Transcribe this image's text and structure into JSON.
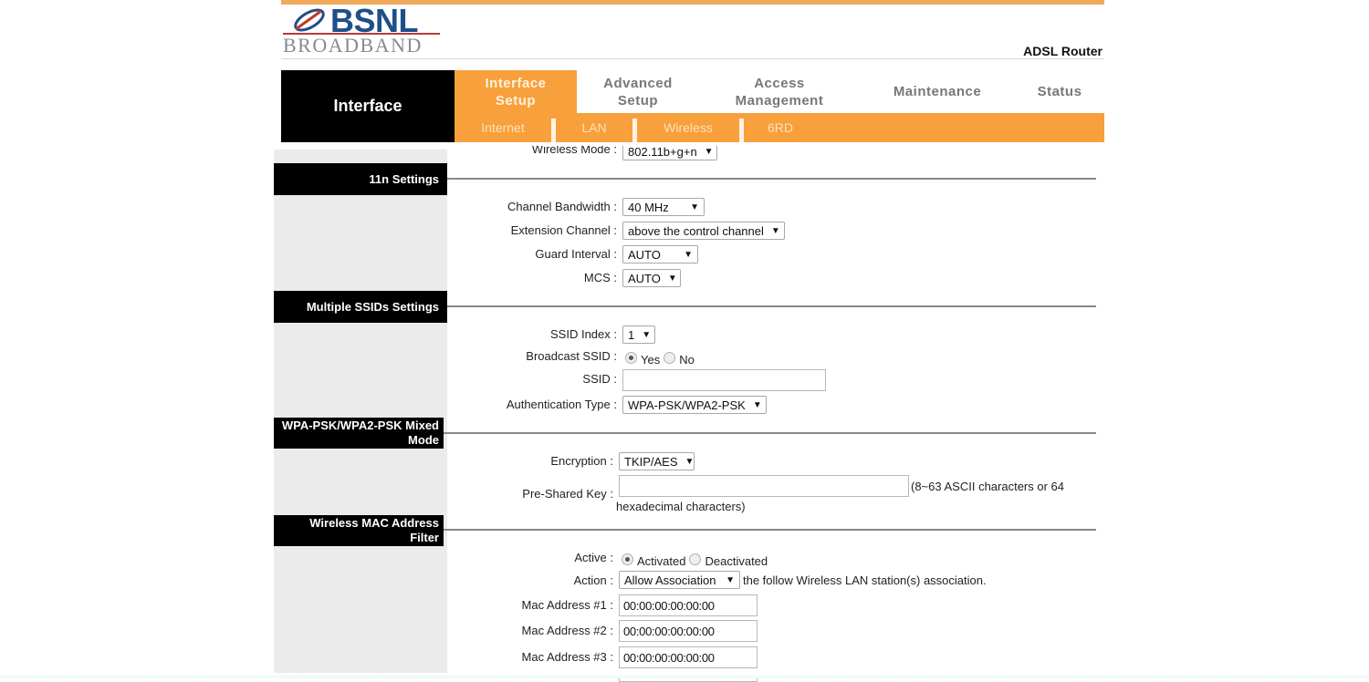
{
  "header": {
    "logo_brand": "BSNL",
    "logo_sub": "BROADBAND",
    "product": "ADSL Router",
    "colors": {
      "accent": "#f7a03c",
      "brand_blue": "#1f4f8a",
      "nav_black": "#000000"
    }
  },
  "nav": {
    "section": "Interface",
    "tabs": [
      {
        "label": "Interface Setup",
        "line1": "Interface",
        "line2": "Setup",
        "active": true
      },
      {
        "label": "Advanced Setup",
        "line1": "Advanced",
        "line2": "Setup",
        "active": false
      },
      {
        "label": "Access Management",
        "line1": "Access",
        "line2": "Management",
        "active": false
      },
      {
        "label": "Maintenance",
        "line1": "Maintenance",
        "line2": "",
        "active": false
      },
      {
        "label": "Status",
        "line1": "Status",
        "line2": "",
        "active": false
      }
    ],
    "subtabs": [
      "Internet",
      "LAN",
      "Wireless",
      "6RD"
    ]
  },
  "wireless_mode": {
    "label": "Wireless Mode :",
    "value": "802.11b+g+n"
  },
  "sections": {
    "n11": {
      "title": "11n Settings",
      "channel_bandwidth": {
        "label": "Channel Bandwidth :",
        "value": "40 MHz"
      },
      "extension_channel": {
        "label": "Extension Channel :",
        "value": "above the control channel"
      },
      "guard_interval": {
        "label": "Guard Interval :",
        "value": "AUTO"
      },
      "mcs": {
        "label": "MCS :",
        "value": "AUTO"
      }
    },
    "ssid": {
      "title": "Multiple SSIDs Settings",
      "ssid_index": {
        "label": "SSID Index :",
        "value": "1"
      },
      "broadcast": {
        "label": "Broadcast SSID :",
        "options": [
          "Yes",
          "No"
        ],
        "selected": "Yes"
      },
      "ssid": {
        "label": "SSID :",
        "value": ""
      },
      "auth_type": {
        "label": "Authentication Type :",
        "value": "WPA-PSK/WPA2-PSK"
      }
    },
    "wpa": {
      "title_line1": "WPA-PSK/WPA2-PSK Mixed",
      "title_line2": "Mode",
      "encryption": {
        "label": "Encryption :",
        "value": "TKIP/AES"
      },
      "psk": {
        "label": "Pre-Shared Key :",
        "value": "",
        "hint_line1": "(8~63 ASCII characters or 64",
        "hint_line2": "hexadecimal characters)"
      }
    },
    "mac_filter": {
      "title_line1": "Wireless MAC Address",
      "title_line2": "Filter",
      "active": {
        "label": "Active :",
        "options": [
          "Activated",
          "Deactivated"
        ],
        "selected": "Activated"
      },
      "action": {
        "label": "Action :",
        "value": "Allow Association",
        "suffix": "the follow Wireless LAN station(s) association."
      },
      "addresses": [
        {
          "label": "Mac Address #1 :",
          "value": "00:00:00:00:00:00"
        },
        {
          "label": "Mac Address #2 :",
          "value": "00:00:00:00:00:00"
        },
        {
          "label": "Mac Address #3 :",
          "value": "00:00:00:00:00:00"
        }
      ]
    }
  }
}
